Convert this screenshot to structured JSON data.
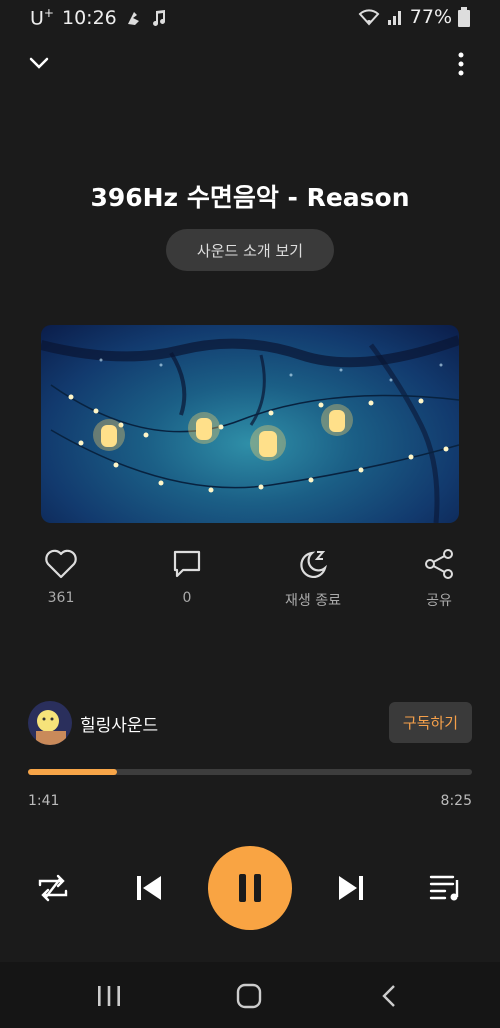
{
  "status_bar": {
    "carrier": "U",
    "carrier_sup": "+",
    "time": "10:26",
    "battery": "77%"
  },
  "track": {
    "title": "396Hz 수면음악 - Reason",
    "intro_button": "사운드 소개 보기"
  },
  "actions": {
    "like_count": "361",
    "comment_count": "0",
    "sleep_timer_label": "재생 종료",
    "share_label": "공유"
  },
  "channel": {
    "name": "힐링사운드",
    "subscribe_label": "구독하기"
  },
  "progress": {
    "current": "1:41",
    "total": "8:25",
    "fraction": 0.2
  },
  "colors": {
    "accent": "#f9a443",
    "background": "#1b1b1b"
  },
  "icons": [
    "chevron-down-icon",
    "more-vert-icon",
    "heart-icon",
    "comment-icon",
    "sleep-timer-icon",
    "share-icon",
    "repeat-icon",
    "previous-icon",
    "pause-icon",
    "next-icon",
    "playlist-icon"
  ]
}
